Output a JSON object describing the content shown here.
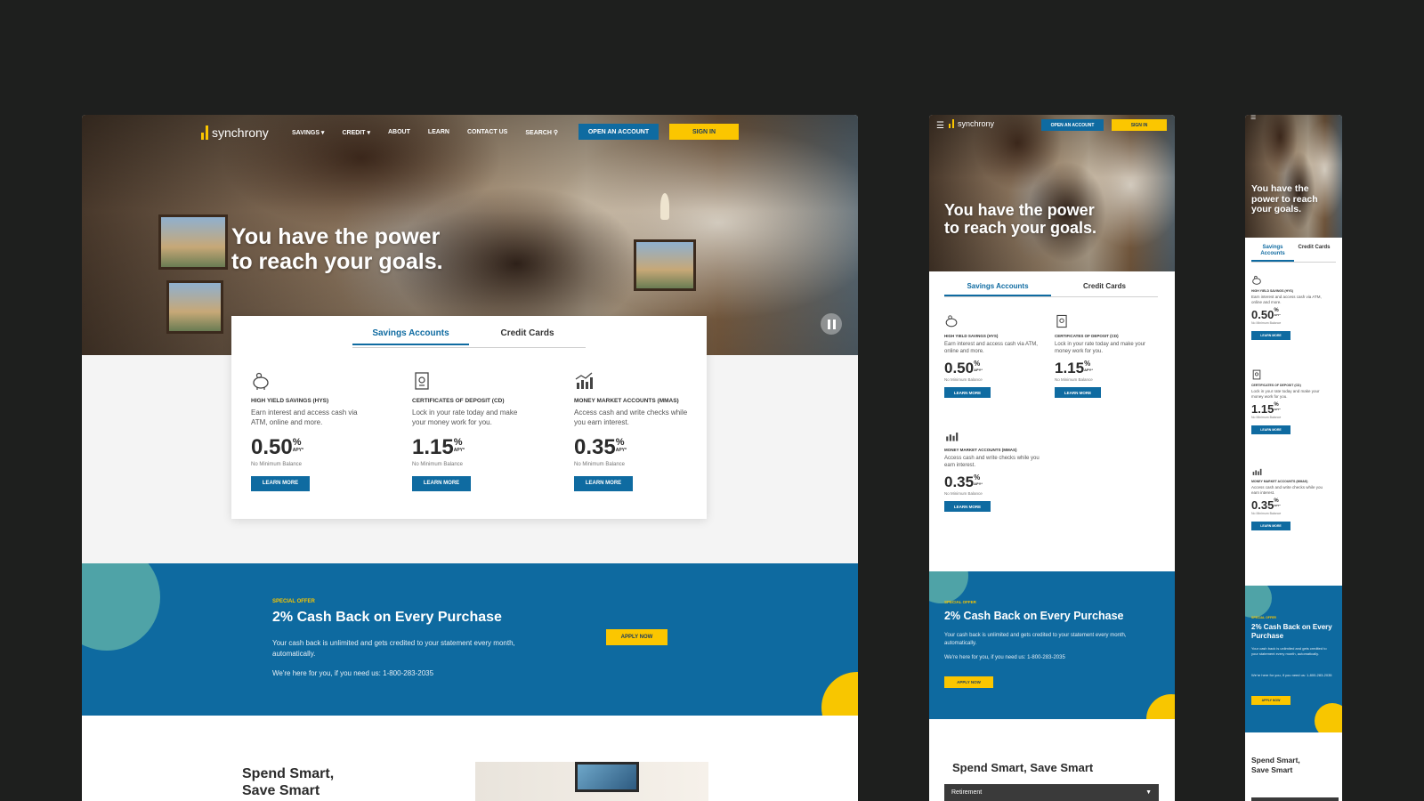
{
  "brand": {
    "name": "synchrony"
  },
  "nav": {
    "items": [
      "SAVINGS ▾",
      "CREDIT ▾",
      "ABOUT",
      "LEARN",
      "CONTACT US"
    ],
    "search": "SEARCH",
    "open_account": "OPEN AN ACCOUNT",
    "sign_in": "SIGN IN"
  },
  "hero": {
    "title": "You have the power\nto reach your goals.",
    "title_phone": "You have the power to reach your goals."
  },
  "tabs": [
    "Savings Accounts",
    "Credit Cards"
  ],
  "tabs_phone": [
    "Savings Accounts",
    "Credit Cards"
  ],
  "products": [
    {
      "icon": "piggy-bank-icon",
      "title": "HIGH YIELD SAVINGS (HYS)",
      "desc": "Earn interest and access cash via ATM, online and more.",
      "rate": "0.50",
      "pct": "%",
      "apy": "APY*",
      "note": "No Minimum Balance",
      "cta": "LEARN MORE"
    },
    {
      "icon": "certificate-icon",
      "title": "CERTIFICATES OF DEPOSIT (CD)",
      "desc": "Lock in your rate today and make your money work for you.",
      "rate": "1.15",
      "pct": "%",
      "apy": "APY*",
      "note": "No Minimum Balance",
      "cta": "LEARN MORE"
    },
    {
      "icon": "chart-icon",
      "title": "MONEY MARKET ACCOUNTS (MMAS)",
      "desc": "Access cash and write checks while you earn interest.",
      "rate": "0.35",
      "pct": "%",
      "apy": "APY*",
      "note": "No Minimum Balance",
      "cta": "LEARN MORE"
    }
  ],
  "promo": {
    "eyebrow": "SPECIAL OFFER",
    "title": "2% Cash Back on Every Purchase",
    "body": "Your cash back is unlimited and gets credited to your statement every month, automatically.",
    "phone": "We're here for you, if you need us: 1-800-283-2035",
    "cta": "APPLY NOW"
  },
  "spend": {
    "title": "Spend Smart,\nSave Smart",
    "title_tablet": "Spend Smart, Save Smart"
  },
  "dropdown": {
    "value": "Retirement"
  },
  "colors": {
    "brand_blue": "#0f6ba1",
    "brand_yellow": "#fbc600",
    "teal": "#4fa3a7",
    "background": "#1e1f1e"
  }
}
